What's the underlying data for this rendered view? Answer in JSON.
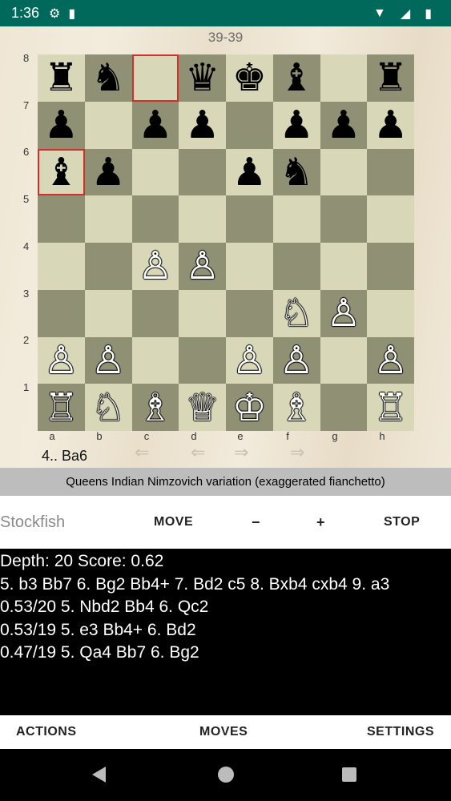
{
  "status_bar": {
    "time": "1:36",
    "gear_icon": "⚙",
    "sd_icon": "▮",
    "wifi_icon": "▼",
    "signal_icon": "◢",
    "battery_icon": "▮"
  },
  "game": {
    "move_count": "39-39",
    "last_move": "4.. Ba6",
    "opening": "Queens Indian Nimzovich variation (exaggerated fianchetto)"
  },
  "board": {
    "ranks": [
      "8",
      "7",
      "6",
      "5",
      "4",
      "3",
      "2",
      "1"
    ],
    "files": [
      "a",
      "b",
      "c",
      "d",
      "e",
      "f",
      "g",
      "h"
    ],
    "rows": [
      [
        "♜",
        "♞",
        "",
        "♛",
        "♚",
        "♝",
        "",
        "♜"
      ],
      [
        "♟",
        "",
        "♟",
        "♟",
        "",
        "♟",
        "♟",
        "♟"
      ],
      [
        "♝",
        "♟",
        "",
        "",
        "♟",
        "♞",
        "",
        ""
      ],
      [
        "",
        "",
        "",
        "",
        "",
        "",
        "",
        ""
      ],
      [
        "",
        "",
        "♙",
        "♙",
        "",
        "",
        "",
        ""
      ],
      [
        "",
        "",
        "",
        "",
        "",
        "♘",
        "♙",
        ""
      ],
      [
        "♙",
        "♙",
        "",
        "",
        "♙",
        "♙",
        "",
        "♙"
      ],
      [
        "♖",
        "♘",
        "♗",
        "♕",
        "♔",
        "♗",
        "",
        "♖"
      ]
    ],
    "colors": [
      [
        "black",
        "black",
        "",
        "black",
        "black",
        "black",
        "",
        "black"
      ],
      [
        "black",
        "",
        "black",
        "black",
        "",
        "black",
        "black",
        "black"
      ],
      [
        "black",
        "black",
        "",
        "",
        "black",
        "black",
        "",
        ""
      ],
      [
        "",
        "",
        "",
        "",
        "",
        "",
        "",
        ""
      ],
      [
        "",
        "",
        "white",
        "white",
        "",
        "",
        "",
        ""
      ],
      [
        "",
        "",
        "",
        "",
        "",
        "white",
        "white",
        ""
      ],
      [
        "white",
        "white",
        "",
        "",
        "white",
        "white",
        "",
        "white"
      ],
      [
        "white",
        "white",
        "white",
        "white",
        "white",
        "white",
        "",
        "white"
      ]
    ],
    "highlight": [
      "c8",
      "a6"
    ]
  },
  "nav_arrows": [
    "⇐",
    "⇐",
    "⇒",
    "⇒"
  ],
  "engine": {
    "name": "Stockfish",
    "move_label": "MOVE",
    "minus_label": "−",
    "plus_label": "+",
    "stop_label": "STOP"
  },
  "analysis": {
    "lines": [
      "Depth: 20 Score: 0.62",
      "5. b3 Bb7 6. Bg2 Bb4+ 7. Bd2 c5 8. Bxb4 cxb4 9. a3",
      "0.53/20 5. Nbd2 Bb4 6. Qc2",
      "0.53/19 5. e3 Bb4+ 6. Bd2",
      "0.47/19 5. Qa4 Bb7 6. Bg2"
    ]
  },
  "menu": {
    "actions": "ACTIONS",
    "moves": "MOVES",
    "settings": "SETTINGS"
  },
  "colors": {
    "status_bar": "#00695c",
    "light_square": "#d8d8b8",
    "dark_square": "#8f9074",
    "highlight": "#d0302b",
    "opening_bar": "#bdbdbd",
    "analysis_bg": "#000000"
  }
}
